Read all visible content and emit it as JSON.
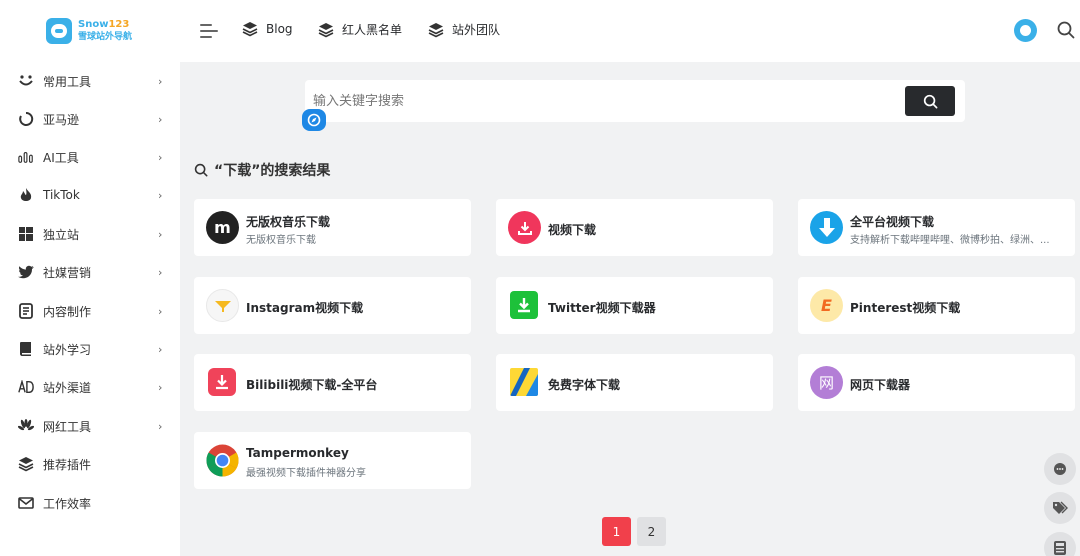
{
  "logo": {
    "line1": "Snow",
    "line1_num": "123",
    "line2": "雪球站外导航"
  },
  "topnav": [
    {
      "label": "Blog"
    },
    {
      "label": "红人黑名单"
    },
    {
      "label": "站外团队"
    }
  ],
  "sidebar": {
    "items": [
      {
        "label": "常用工具",
        "icon": "smile-icon",
        "has_chevron": true
      },
      {
        "label": "亚马逊",
        "icon": "amazon-icon",
        "has_chevron": true
      },
      {
        "label": "AI工具",
        "icon": "ai-bars-icon",
        "has_chevron": true
      },
      {
        "label": "TikTok",
        "icon": "flame-icon",
        "has_chevron": true
      },
      {
        "label": "独立站",
        "icon": "windows-icon",
        "has_chevron": true
      },
      {
        "label": "社媒营销",
        "icon": "twitter-icon",
        "has_chevron": true
      },
      {
        "label": "内容制作",
        "icon": "document-icon",
        "has_chevron": true
      },
      {
        "label": "站外学习",
        "icon": "book-icon",
        "has_chevron": true
      },
      {
        "label": "站外渠道",
        "icon": "ad-icon",
        "has_chevron": true
      },
      {
        "label": "网红工具",
        "icon": "huawei-icon",
        "has_chevron": true
      },
      {
        "label": "推荐插件",
        "icon": "layers-icon",
        "has_chevron": false
      },
      {
        "label": "工作效率",
        "icon": "mail-icon",
        "has_chevron": false
      }
    ]
  },
  "search": {
    "placeholder": "输入关键字搜索",
    "value": ""
  },
  "results": {
    "heading": "“下载”的搜索结果",
    "cards": [
      {
        "title": "无版权音乐下载",
        "desc": "无版权音乐下载",
        "icon": "m-logo-icon"
      },
      {
        "title": "视频下载",
        "desc": "",
        "icon": "video-download-icon"
      },
      {
        "title": "全平台视频下载",
        "desc": "支持解析下载哔哩哔哩、微博秒拍、绿洲、...",
        "icon": "download-arrow-icon"
      },
      {
        "title": "Instagram视频下载",
        "desc": "",
        "icon": "instagram-funnel-icon"
      },
      {
        "title": "Twitter视频下载器",
        "desc": "",
        "icon": "green-download-icon"
      },
      {
        "title": "Pinterest视频下载",
        "desc": "",
        "icon": "e-logo-icon"
      },
      {
        "title": "Bilibili视频下载-全平台",
        "desc": "",
        "icon": "bilibili-download-icon"
      },
      {
        "title": "免费字体下载",
        "desc": "",
        "icon": "font-logo-icon"
      },
      {
        "title": "网页下载器",
        "desc": "",
        "icon": "wang-logo-icon",
        "icon_text": "网"
      },
      {
        "title": "Tampermonkey",
        "desc": "最强视频下载插件神器分享",
        "icon": "chrome-icon"
      }
    ]
  },
  "pagination": {
    "pages": [
      "1",
      "2"
    ],
    "active": "1"
  },
  "colors": {
    "accent": "#f1404b",
    "brand": "#3ab0e8",
    "dark": "#282a2d"
  }
}
